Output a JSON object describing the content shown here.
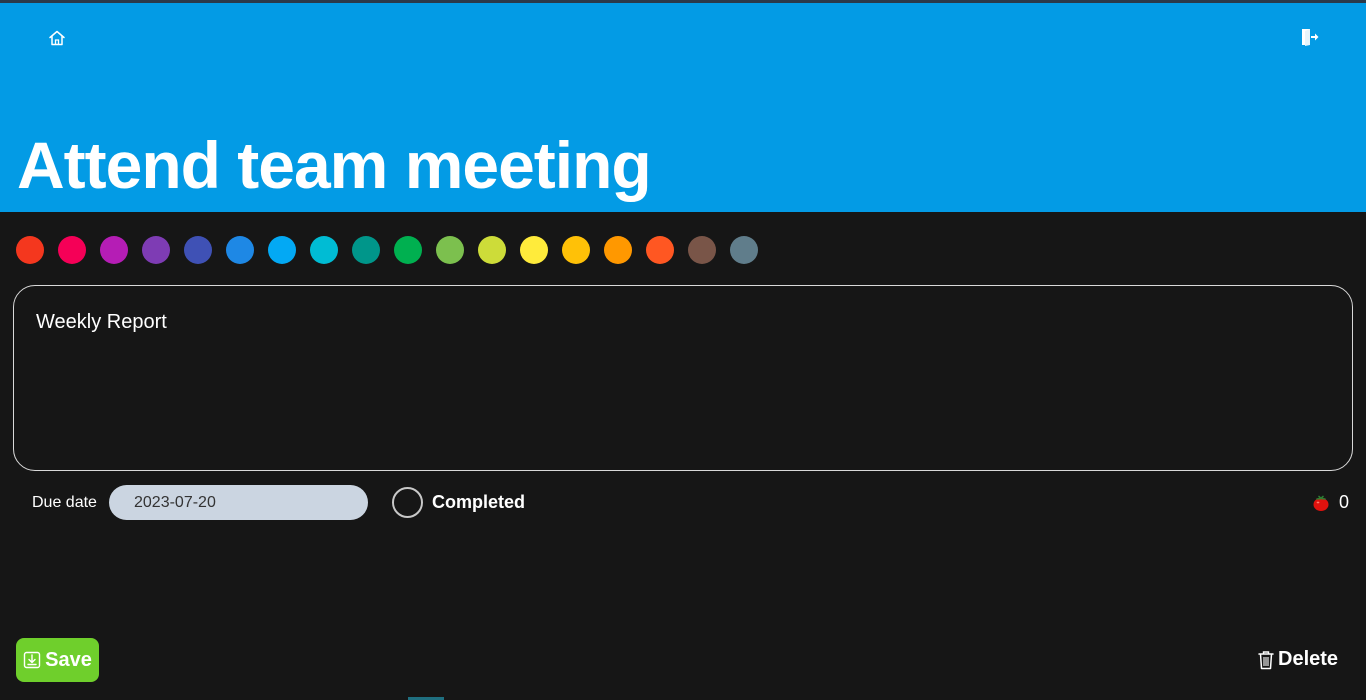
{
  "header": {
    "title": "Attend team meeting",
    "color": "#039be5",
    "home_icon": "home-icon",
    "logout_icon": "logout-icon"
  },
  "palette": {
    "colors": [
      "#f4371e",
      "#f50057",
      "#b51db5",
      "#7e3cb4",
      "#3f51b5",
      "#1e88e5",
      "#03a9f4",
      "#00bcd4",
      "#00968a",
      "#00b050",
      "#7cc04e",
      "#cddc39",
      "#ffeb3b",
      "#ffc107",
      "#ff9800",
      "#ff5722",
      "#795548",
      "#607d8b"
    ]
  },
  "notes": {
    "value": "Weekly Report"
  },
  "due": {
    "label": "Due date",
    "value": "2023-07-20"
  },
  "completed": {
    "label": "Completed",
    "checked": false
  },
  "pomodoro": {
    "icon": "tomato-icon",
    "count": "0"
  },
  "actions": {
    "save_label": "Save",
    "save_icon": "save-icon",
    "delete_label": "Delete",
    "delete_icon": "trash-icon"
  }
}
